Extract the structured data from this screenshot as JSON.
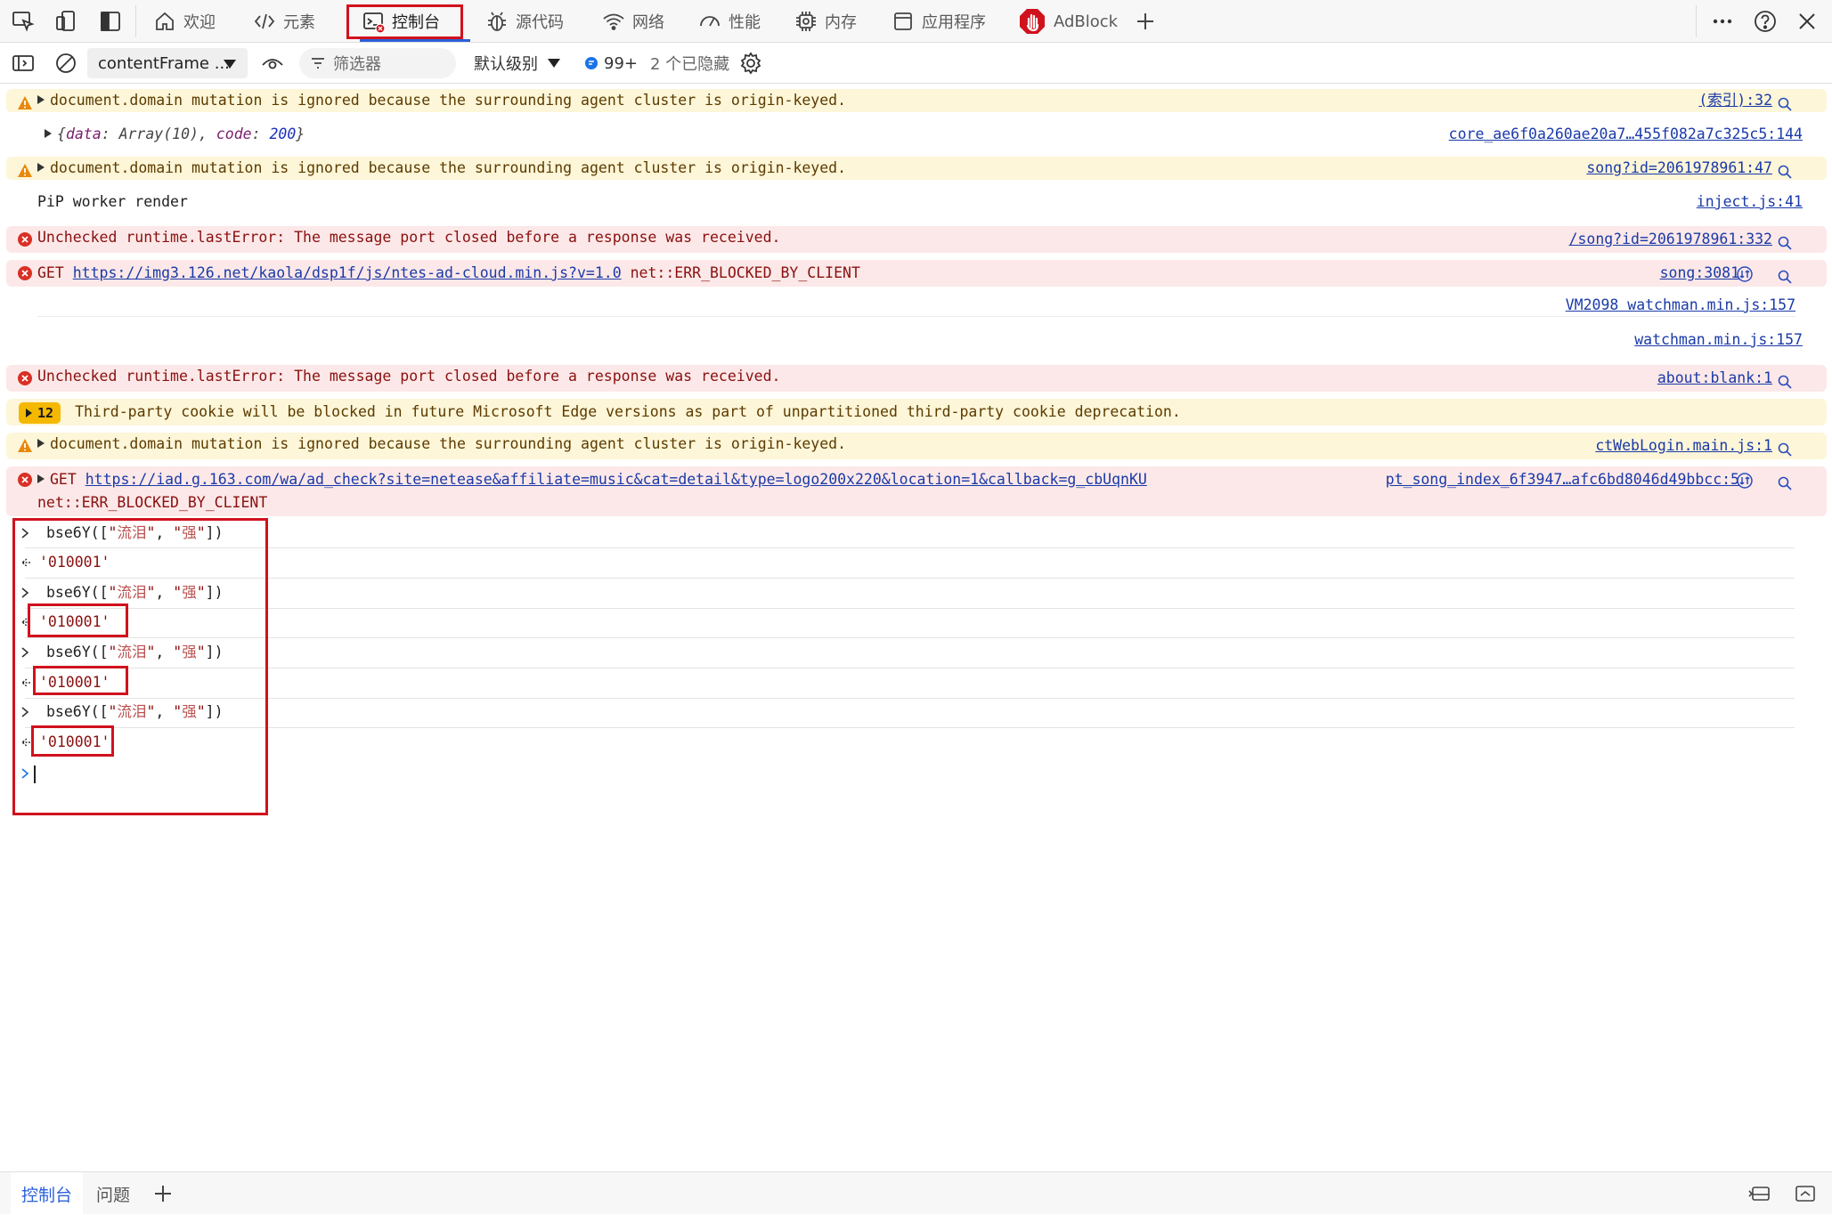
{
  "tabs": [
    {
      "label": "欢迎",
      "icon": "home-icon"
    },
    {
      "label": "元素",
      "icon": "code-icon"
    },
    {
      "label": "控制台",
      "icon": "console-icon"
    },
    {
      "label": "源代码",
      "icon": "bug-icon"
    },
    {
      "label": "网络",
      "icon": "wifi-icon"
    },
    {
      "label": "性能",
      "icon": "gauge-icon"
    },
    {
      "label": "内存",
      "icon": "chip-icon"
    },
    {
      "label": "应用程序",
      "icon": "window-icon"
    },
    {
      "label": "AdBlock",
      "icon": "adblock-icon"
    }
  ],
  "toolbar": {
    "context": "contentFrame ...",
    "filter_placeholder": "筛选器",
    "level": "默认级别",
    "issues_count": "99+",
    "hidden": "2 个已隐藏"
  },
  "messages": [
    {
      "level": "warning",
      "text": "document.domain mutation is ignored because the surrounding agent cluster is origin-keyed.",
      "source": "(索引):32"
    },
    {
      "level": "info",
      "object": {
        "open": "{",
        "k1": "data",
        "v1": "Array(10)",
        "k2": "code",
        "v2": "200",
        "close": "}"
      },
      "source": "core_ae6f0a260ae20a7…455f082a7c325c5:144"
    },
    {
      "level": "warning",
      "text": "document.domain mutation is ignored because the surrounding agent cluster is origin-keyed.",
      "source": "song?id=2061978961:47"
    },
    {
      "level": "info",
      "text": "PiP worker render",
      "source": "inject.js:41"
    },
    {
      "level": "error",
      "text": "Unchecked runtime.lastError: The message port closed before a response was received.",
      "source": "/song?id=2061978961:332"
    },
    {
      "level": "error",
      "method": "GET",
      "url": "https://img3.126.net/kaola/dsp1f/js/ntes-ad-cloud.min.js?v=1.0",
      "error": "net::ERR_BLOCKED_BY_CLIENT",
      "source": "song:3081",
      "stack": [
        "VM2098 watchman.min.js:157",
        "watchman.min.js:157"
      ]
    },
    {
      "level": "error",
      "text": "Unchecked runtime.lastError: The message port closed before a response was received.",
      "source": "about:blank:1"
    },
    {
      "level": "issue",
      "count": "12",
      "text": "Third-party cookie will be blocked in future Microsoft Edge versions as part of unpartitioned third-party cookie deprecation."
    },
    {
      "level": "warning",
      "text": "document.domain mutation is ignored because the surrounding agent cluster is origin-keyed.",
      "source": "ctWebLogin.main.js:1"
    },
    {
      "level": "error",
      "method": "GET",
      "url": "https://iad.g.163.com/wa/ad_check?site=netease&affiliate=music&cat=detail&type=logo200x220&location=1&callback=g_cbUqnKU",
      "error": "net::ERR_BLOCKED_BY_CLIENT",
      "source": "pt_song_index_6f3947…afc6bd8046d49bbcc:5"
    }
  ],
  "repl": {
    "fn": "bse6Y([",
    "q": "\"",
    "arg1": "流泪",
    "sep": ", ",
    "arg2": "强",
    "end": "])",
    "result": "'010001'"
  },
  "drawer": {
    "tabs": [
      "控制台",
      "问题"
    ]
  },
  "colors": {
    "accent": "#2b5fd9",
    "highlight": "#d0121d",
    "warning_bg": "#fdf6d8",
    "error_bg": "#fce8e8"
  }
}
